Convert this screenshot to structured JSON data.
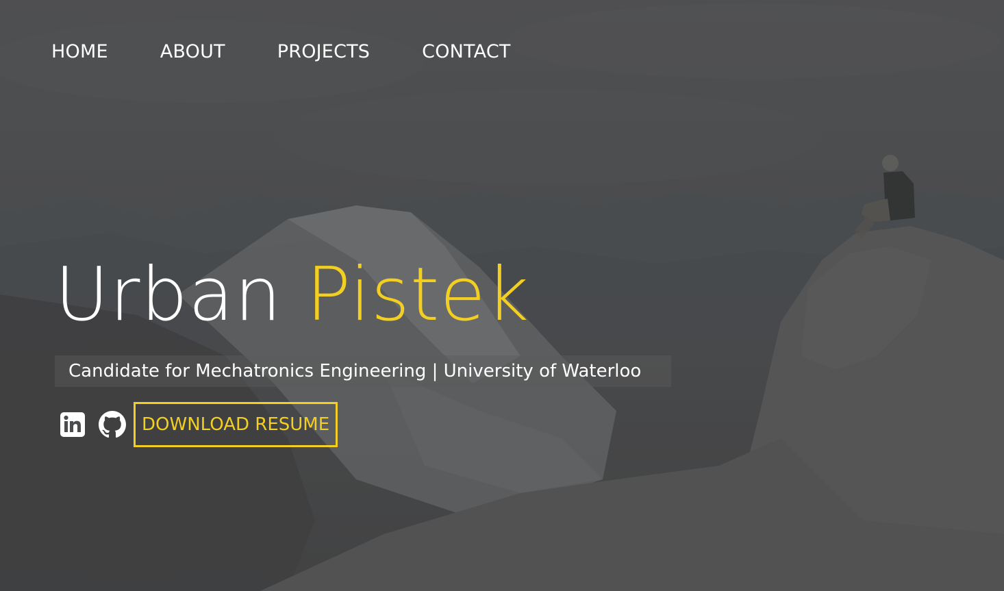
{
  "nav": {
    "items": [
      {
        "label": "HOME"
      },
      {
        "label": "ABOUT"
      },
      {
        "label": "PROJECTS"
      },
      {
        "label": "CONTACT"
      }
    ]
  },
  "hero": {
    "first_name": "Urban",
    "last_name": "Pistek",
    "subtitle": "Candidate for Mechatronics Engineering | University of Waterloo",
    "resume_button": "DOWNLOAD RESUME"
  },
  "icons": {
    "social": [
      "linkedin-icon",
      "github-icon"
    ]
  },
  "colors": {
    "accent": "#f2cf22",
    "text": "#ffffff",
    "overlay": "#4a4b4d"
  }
}
